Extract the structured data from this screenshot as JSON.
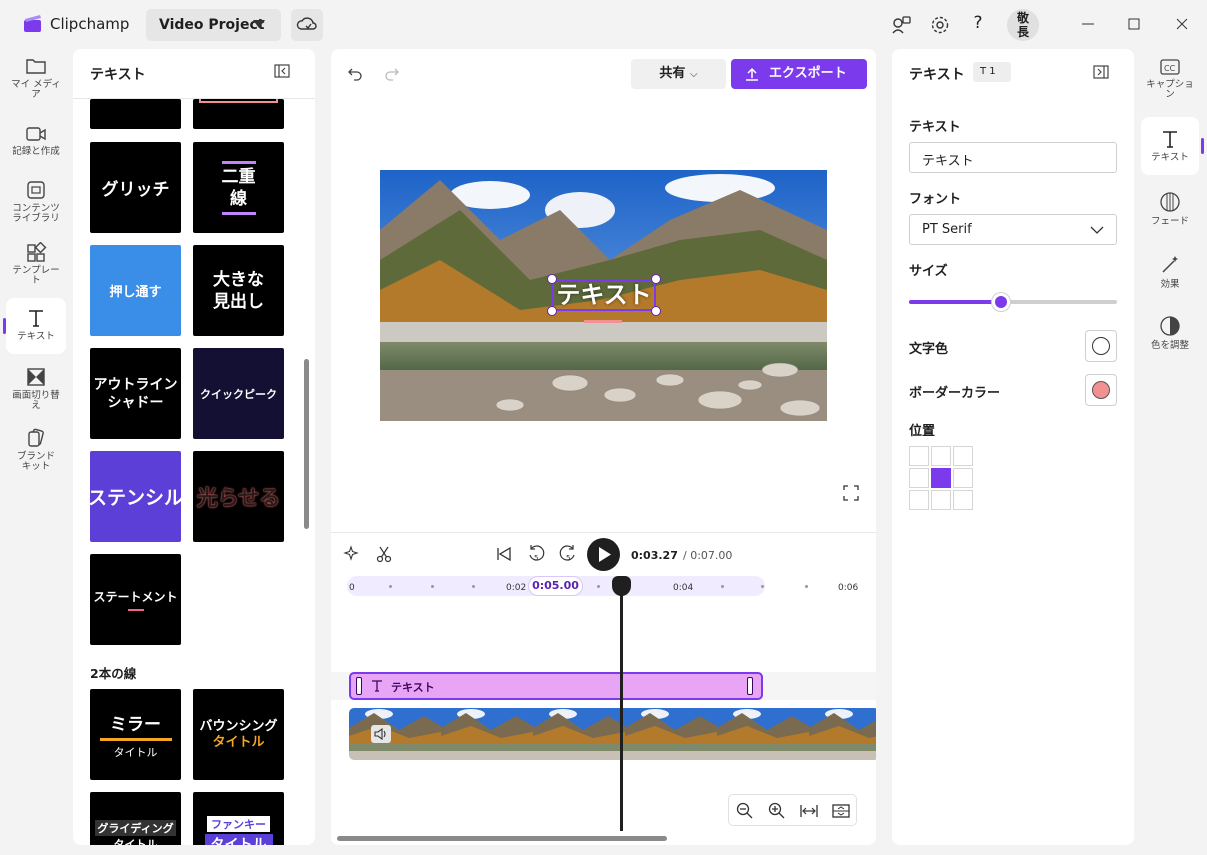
{
  "app": {
    "name": "Clipchamp",
    "project_label": "Video Project",
    "avatar_initials_1": "敬",
    "avatar_initials_2": "長"
  },
  "left_rail": [
    {
      "label_1": "マイ メディ",
      "label_2": "ア"
    },
    {
      "label_1": "記録と作成",
      "label_2": ""
    },
    {
      "label_1": "コンテンツ",
      "label_2": "ライブラリ"
    },
    {
      "label_1": "テンプレー",
      "label_2": "ト"
    },
    {
      "label_1": "テキスト",
      "label_2": ""
    },
    {
      "label_1": "画面切り替",
      "label_2": "え"
    },
    {
      "label_1": "ブランド",
      "label_2": "キット"
    }
  ],
  "text_panel": {
    "title": "テキスト",
    "tiles": [
      {
        "line1": "グリッチ",
        "line2": ""
      },
      {
        "line1": "二重",
        "line2": "線"
      },
      {
        "line1": "押し通す",
        "line2": ""
      },
      {
        "line1": "大きな",
        "line2": "見出し"
      },
      {
        "line1": "アウトライン",
        "line2": "シャドー"
      },
      {
        "line1": "クイックピーク",
        "line2": ""
      },
      {
        "line1": "ステンシル",
        "line2": ""
      },
      {
        "line1": "光らせる",
        "line2": ""
      },
      {
        "line1": "ステートメント",
        "line2": ""
      },
      {
        "line1": "ミラー",
        "line2": "タイトル"
      },
      {
        "line1": "バウンシング",
        "line2": "タイトル"
      },
      {
        "line1": "グライディング",
        "line2": "タイトル"
      },
      {
        "line1": "ファンキー",
        "line2": "タイトル"
      }
    ],
    "section_two_lines": "2本の線"
  },
  "toolbar": {
    "share_label": "共有",
    "export_label": "エクスポート"
  },
  "preview": {
    "overlay_text": "テキスト"
  },
  "timeline": {
    "current_time": "0:03.27",
    "total_time": "/ 0:07.00",
    "hover_time": "0:05.00",
    "ticks": [
      "0",
      "0:02",
      "0:04",
      "0:06"
    ],
    "text_clip_label": "テキスト",
    "playhead_fraction": 0.467
  },
  "props": {
    "title": "テキスト",
    "badge_count": "1",
    "text_label": "テキスト",
    "text_value": "テキスト",
    "font_label": "フォント",
    "font_value": "PT Serif",
    "size_label": "サイズ",
    "size_fraction": 0.44,
    "text_color_label": "文字色",
    "text_color": "#ffffff",
    "border_color_label": "ボーダーカラー",
    "border_color": "#f29191",
    "position_label": "位置",
    "position_selected": 4,
    "accent": "#7c3aed"
  },
  "right_rail": [
    {
      "label_1": "キャプショ",
      "label_2": "ン"
    },
    {
      "label_1": "テキスト",
      "label_2": ""
    },
    {
      "label_1": "フェード",
      "label_2": ""
    },
    {
      "label_1": "効果",
      "label_2": ""
    },
    {
      "label_1": "色を調整",
      "label_2": ""
    }
  ]
}
